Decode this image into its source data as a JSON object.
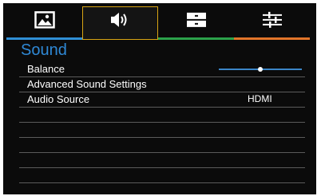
{
  "colors": {
    "background": "#0b0b0b",
    "title": "#2f89d6",
    "tab_lines": [
      "#2f8fd6",
      "#d9a514",
      "#2ca24a",
      "#e2752a"
    ],
    "active_tab_border": "#d9a514"
  },
  "tabs": [
    {
      "icon": "picture-icon",
      "active": false
    },
    {
      "icon": "speaker-icon",
      "active": true
    },
    {
      "icon": "setup-icon",
      "active": false
    },
    {
      "icon": "settings-sliders-icon",
      "active": false
    }
  ],
  "page_title": "Sound",
  "menu": [
    {
      "label": "Balance",
      "slider_fraction": 0.5
    },
    {
      "label": "Advanced Sound Settings"
    },
    {
      "label": "Audio Source",
      "value": "HDMI"
    }
  ]
}
